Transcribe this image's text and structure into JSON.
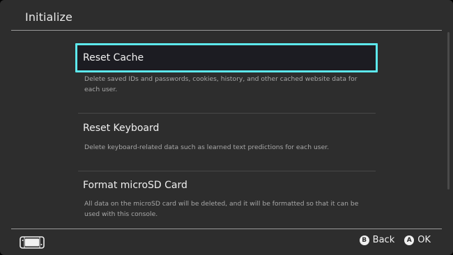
{
  "header": {
    "title": "Initialize"
  },
  "items": [
    {
      "label": "Reset Cache",
      "description": "Delete saved IDs and passwords, cookies, history, and other cached website data for each user."
    },
    {
      "label": "Reset Keyboard",
      "description": "Delete keyboard-related data such as learned text predictions for each user."
    },
    {
      "label": "Format microSD Card",
      "description": "All data on the microSD card will be deleted, and it will be formatted so that it can be used with this console."
    }
  ],
  "footer": {
    "console_icon": "console-icon",
    "back": {
      "button_glyph": "B",
      "label": "Back"
    },
    "ok": {
      "button_glyph": "A",
      "label": "OK"
    }
  },
  "colors": {
    "background": "#2d2d2d",
    "selection_border": "#5de8ec",
    "selection_fill": "#1c1c22",
    "text_primary": "#f0f0f0",
    "text_secondary": "#a8a8a8"
  }
}
